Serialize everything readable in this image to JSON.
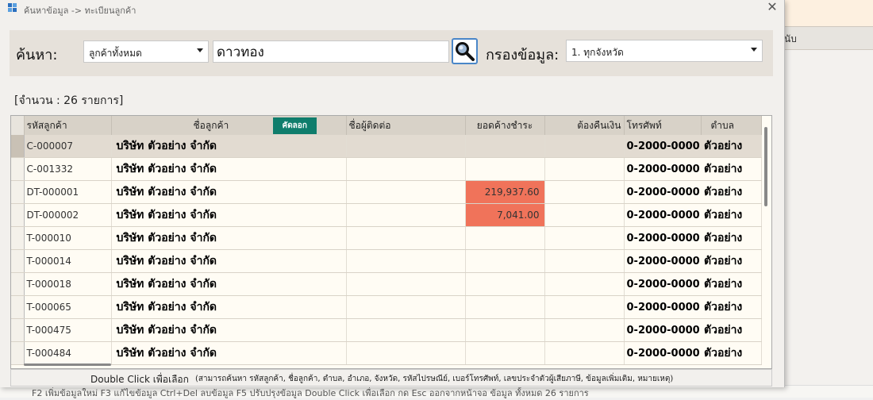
{
  "window": {
    "title": "ค้นหาข้อมูล -> ทะเบียนลูกค้า",
    "close_glyph": "✕"
  },
  "background": {
    "header_text": "นับ",
    "footer_text": "F2 เพิ่มข้อมูลใหม่   F3 แก้ไขข้อมูล   Ctrl+Del ลบข้อมูล   F5 ปรับปรุงข้อมูล   Double Click เพื่อเลือก   กด Esc ออกจากหน้าจอ   ข้อมูล ทั้งหมด 26 รายการ"
  },
  "search": {
    "label": "ค้นหา:",
    "scope_dropdown": "ลูกค้าทั้งหมด",
    "query": "ดาวทอง",
    "filter_label": "กรองข้อมูล:",
    "filter_dropdown": "1. ทุกจังหวัด"
  },
  "count_text": "[จำนวน : 26 รายการ]",
  "grid": {
    "columns": {
      "code": "รหัสลูกค้า",
      "name": "ชื่อลูกค้า",
      "contact": "ชื่อผู้ติดต่อ",
      "balance": "ยอดค้างชำระ",
      "refund": "ต้องคืนเงิน",
      "phone": "โทรศัพท์",
      "subdistrict": "ตำบล"
    },
    "copy_button": "คัดลอก",
    "rows": [
      {
        "code": "C-000007",
        "name": "บริษัท ตัวอย่าง จำกัด",
        "contact": "",
        "balance": "",
        "refund": "",
        "phone": "0-2000-0000",
        "subdistrict": "ตัวอย่าง",
        "selected": true
      },
      {
        "code": "C-001332",
        "name": "บริษัท ตัวอย่าง จำกัด",
        "contact": "",
        "balance": "",
        "refund": "",
        "phone": "0-2000-0000",
        "subdistrict": "ตัวอย่าง"
      },
      {
        "code": "DT-000001",
        "name": "บริษัท ตัวอย่าง จำกัด",
        "contact": "",
        "balance": "219,937.60",
        "refund": "",
        "phone": "0-2000-0000",
        "subdistrict": "ตัวอย่าง",
        "overdue": true
      },
      {
        "code": "DT-000002",
        "name": "บริษัท ตัวอย่าง จำกัด",
        "contact": "",
        "balance": "7,041.00",
        "refund": "",
        "phone": "0-2000-0000",
        "subdistrict": "ตัวอย่าง",
        "overdue": true
      },
      {
        "code": "T-000010",
        "name": "บริษัท ตัวอย่าง จำกัด",
        "contact": "",
        "balance": "",
        "refund": "",
        "phone": "0-2000-0000",
        "subdistrict": "ตัวอย่าง"
      },
      {
        "code": "T-000014",
        "name": "บริษัท ตัวอย่าง จำกัด",
        "contact": "",
        "balance": "",
        "refund": "",
        "phone": "0-2000-0000",
        "subdistrict": "ตัวอย่าง"
      },
      {
        "code": "T-000018",
        "name": "บริษัท ตัวอย่าง จำกัด",
        "contact": "",
        "balance": "",
        "refund": "",
        "phone": "0-2000-0000",
        "subdistrict": "ตัวอย่าง"
      },
      {
        "code": "T-000065",
        "name": "บริษัท ตัวอย่าง จำกัด",
        "contact": "",
        "balance": "",
        "refund": "",
        "phone": "0-2000-0000",
        "subdistrict": "ตัวอย่าง"
      },
      {
        "code": "T-000475",
        "name": "บริษัท ตัวอย่าง จำกัด",
        "contact": "",
        "balance": "",
        "refund": "",
        "phone": "0-2000-0000",
        "subdistrict": "ตัวอย่าง"
      },
      {
        "code": "T-000484",
        "name": "บริษัท ตัวอย่าง จำกัด",
        "contact": "",
        "balance": "",
        "refund": "",
        "phone": "0-2000-0000",
        "subdistrict": "ตัวอย่าง"
      }
    ]
  },
  "status": {
    "hint": "Double Click เพื่อเลือก",
    "details": "(สามารถค้นหา รหัสลูกค้า, ชื่อลูกค้า, ตำบล, อำเภอ, จังหวัด, รหัสไปรษณีย์, เบอร์โทรศัพท์, เลขประจำตัวผู้เสียภาษี, ข้อมูลเพิ่มเติม, หมายเหตุ)"
  },
  "colors": {
    "overdue": "#f0735a",
    "copy_button": "#0f7d6c",
    "search_button_border": "#4a86c8"
  },
  "icons": {
    "app": "app-grid-icon",
    "search": "magnifier-icon",
    "close": "close-icon"
  }
}
